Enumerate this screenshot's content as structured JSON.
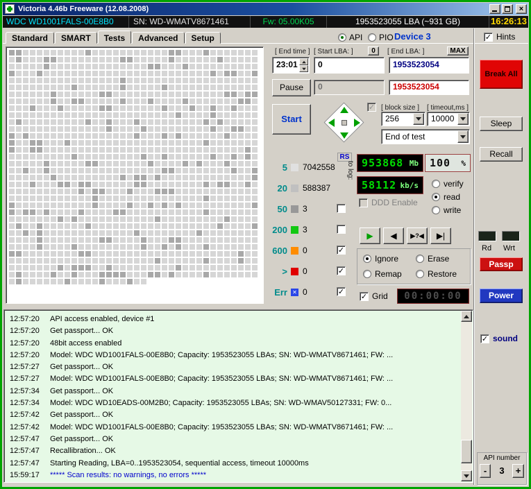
{
  "window": {
    "title": "Victoria 4.46b Freeware (12.08.2008)"
  },
  "infobar": {
    "model": "WDC WD1001FALS-00E8B0",
    "serial": "SN: WD-WMATV8671461",
    "firmware": "Fw: 05.00K05",
    "capacity": "1953523055 LBA (~931 GB)",
    "clock": "16:26:13"
  },
  "tabs": {
    "items": [
      "Standard",
      "SMART",
      "Tests",
      "Advanced",
      "Setup"
    ],
    "active_index": 2
  },
  "mode": {
    "api": "API",
    "pio": "PIO",
    "device": "Device 3",
    "hints": "Hints"
  },
  "test_setup": {
    "end_time_label": "[ End time ]",
    "end_time_value": "23:01",
    "start_lba_label": "[ Start LBA: ]",
    "reset_zero_button": "0",
    "start_lba_value": "0",
    "end_lba_label": "[ End LBA: ]",
    "max_button": "MAX",
    "end_lba_value": "1953523054",
    "pause_button": "Pause",
    "paused_lba_value": "0",
    "current_lba_value": "1953523054",
    "start_button": "Start",
    "block_size_label": "[ block size ]",
    "block_size_value": "256",
    "timeout_label": "[ timeout,ms ]",
    "timeout_value": "10000",
    "end_action_value": "End of test"
  },
  "legend": {
    "rs_button": "RS",
    "to_log_label": "to log:",
    "rows": [
      {
        "threshold": "5",
        "count": "7042558",
        "color": "#e0e0e0",
        "has_checkbox": false,
        "checked": false
      },
      {
        "threshold": "20",
        "count": "588387",
        "color": "#c0c0c0",
        "has_checkbox": false,
        "checked": false
      },
      {
        "threshold": "50",
        "count": "3",
        "color": "#989898",
        "has_checkbox": true,
        "checked": false
      },
      {
        "threshold": "200",
        "count": "3",
        "color": "#12c812",
        "has_checkbox": true,
        "checked": false
      },
      {
        "threshold": "600",
        "count": "0",
        "color": "#ff8c00",
        "has_checkbox": true,
        "checked": true
      },
      {
        "threshold": ">",
        "count": "0",
        "color": "#e00000",
        "has_checkbox": true,
        "checked": true
      },
      {
        "threshold": "Err",
        "count": "0",
        "color": "#2a46e8",
        "has_checkbox": true,
        "checked": true,
        "glyph": "✕"
      }
    ]
  },
  "readouts": {
    "mb_value": "953868",
    "mb_unit": "Mb",
    "percent_value": "100",
    "percent_unit": "%",
    "speed_value": "58112",
    "speed_unit": "kb/s",
    "ddd_label": "DDD Enable",
    "access_modes": [
      "verify",
      "read",
      "write"
    ],
    "access_selected": "read",
    "media": {
      "play": "▶",
      "back": "◀",
      "question": "▶?◀",
      "end": "▶|"
    },
    "actions": [
      "Ignore",
      "Erase",
      "Remap",
      "Restore"
    ],
    "action_selected": "Ignore",
    "grid_label": "Grid",
    "timer_value": "00:00:00"
  },
  "sidebar": {
    "break_all": "Break All",
    "sleep": "Sleep",
    "recall": "Recall",
    "rd": "Rd",
    "wrt": "Wrt",
    "passp": "Passp",
    "power": "Power",
    "sound": "sound",
    "api_number_label": "API number",
    "minus": "-",
    "plus": "+",
    "api_number": "3"
  },
  "log": {
    "lines": [
      {
        "time": "12:57:20",
        "text": "API access enabled, device #1"
      },
      {
        "time": "12:57:20",
        "text": "Get passport... OK"
      },
      {
        "time": "12:57:20",
        "text": "48bit access enabled"
      },
      {
        "time": "12:57:20",
        "text": "Model: WDC WD1001FALS-00E8B0; Capacity: 1953523055 LBAs; SN: WD-WMATV8671461; FW: ..."
      },
      {
        "time": "12:57:27",
        "text": "Get passport... OK"
      },
      {
        "time": "12:57:27",
        "text": "Model: WDC WD1001FALS-00E8B0; Capacity: 1953523055 LBAs; SN: WD-WMATV8671461; FW: ..."
      },
      {
        "time": "12:57:34",
        "text": "Get passport... OK"
      },
      {
        "time": "12:57:34",
        "text": "Model: WDC WD10EADS-00M2B0; Capacity: 1953523055 LBAs; SN: WD-WMAV50127331; FW: 0..."
      },
      {
        "time": "12:57:42",
        "text": "Get passport... OK"
      },
      {
        "time": "12:57:42",
        "text": "Model: WDC WD1001FALS-00E8B0; Capacity: 1953523055 LBAs; SN: WD-WMATV8671461; FW: ..."
      },
      {
        "time": "12:57:47",
        "text": "Get passport... OK"
      },
      {
        "time": "12:57:47",
        "text": "Recallibration... OK"
      },
      {
        "time": "12:57:47",
        "text": "Starting Reading, LBA=0..1953523054, sequential access, timeout 10000ms"
      },
      {
        "time": "15:59:17",
        "text": "***** Scan results: no warnings, no errors *****",
        "highlight": true
      }
    ]
  },
  "scan_grid": {
    "cols": 36,
    "rows": 36,
    "filled_full_rows": 33,
    "partial_last_row": 20,
    "light_color": "#d6d6d6",
    "dark_color": "#a8a8a8",
    "dark_ratio": 0.17,
    "seed": 7
  },
  "colors": {
    "accent_green": "#00a400",
    "lcd_green": "#00dd00",
    "device_blue": "#0033cc",
    "value_navy": "#000080",
    "value_red": "#cc0000",
    "log_highlight": "#0000cc"
  }
}
